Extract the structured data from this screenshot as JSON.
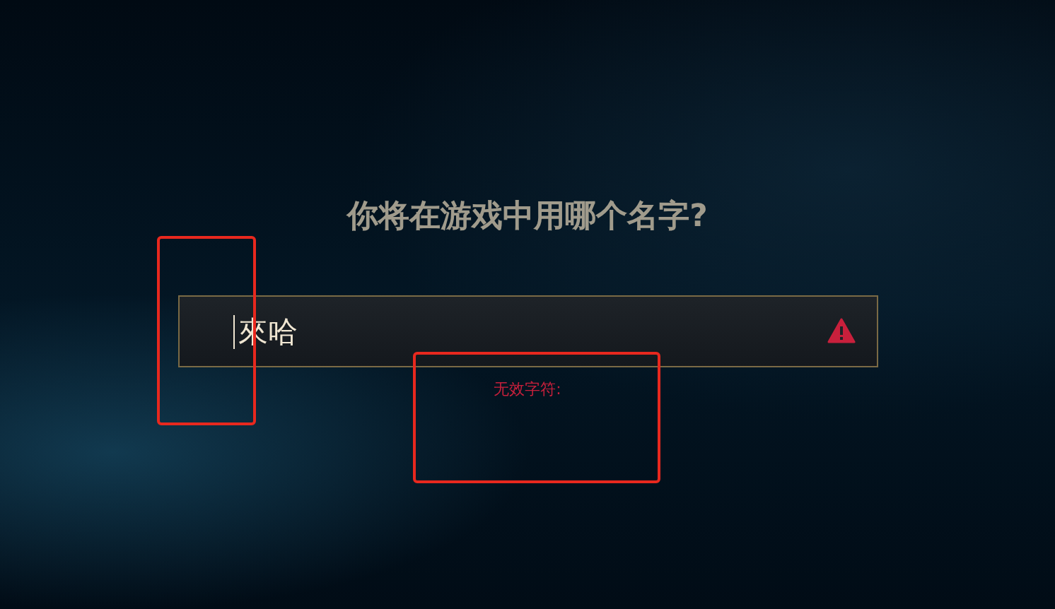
{
  "prompt": {
    "title": "你将在游戏中用哪个名字?"
  },
  "name_field": {
    "value": "來哈",
    "invalid": true
  },
  "error_message": "无效字符:"
}
